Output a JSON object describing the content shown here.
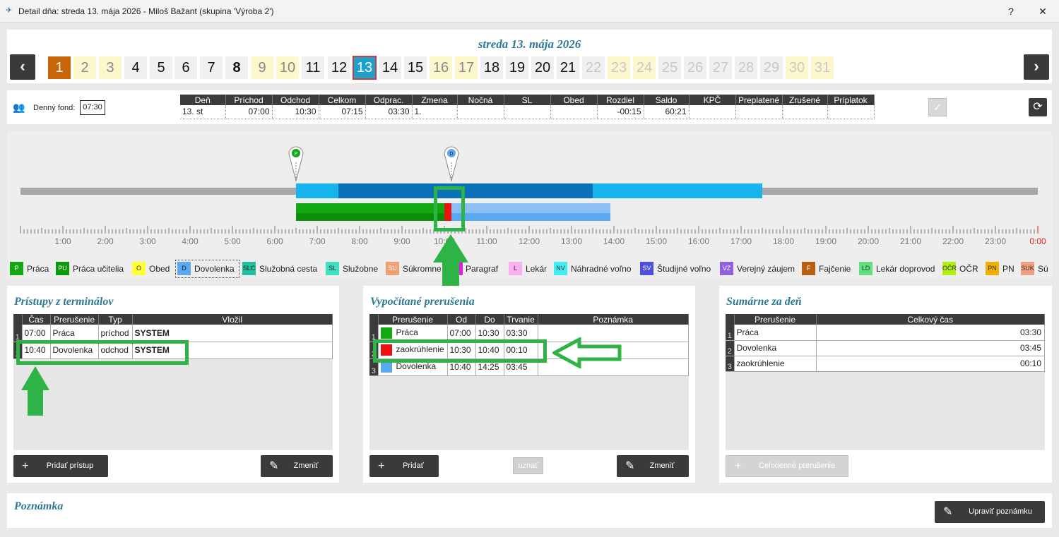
{
  "window": {
    "title": "Detail dňa: streda 13. mája 2026 -  Miloš Bažant  (skupina 'Výroba 2')",
    "help": "?",
    "close": "✕"
  },
  "calendar": {
    "date_title": "streda 13. mája 2026",
    "prev": "‹",
    "next": "›",
    "days": [
      "1",
      "2",
      "3",
      "4",
      "5",
      "6",
      "7",
      "8",
      "9",
      "10",
      "11",
      "12",
      "13",
      "14",
      "15",
      "16",
      "17",
      "18",
      "19",
      "20",
      "21",
      "22",
      "23",
      "24",
      "25",
      "26",
      "27",
      "28",
      "29",
      "30",
      "31"
    ]
  },
  "summary": {
    "fund_label": "Denný fond:",
    "fund_value": "07:30",
    "headers": [
      "Deň",
      "Príchod",
      "Odchod",
      "Celkom",
      "Odprac.",
      "Zmena",
      "Nočná",
      "SL",
      "Obed",
      "Rozdiel",
      "Saldo",
      "KPČ",
      "Preplatené",
      "Zrušené",
      "Príplatok"
    ],
    "row": [
      "13. st",
      "07:00",
      "10:30",
      "07:15",
      "03:30",
      "1.",
      "",
      "",
      "",
      "-00:15",
      "60:21",
      "",
      "",
      "",
      ""
    ],
    "check": "✓",
    "refresh": "⟳"
  },
  "timeline": {
    "markers": [
      {
        "letter": "P",
        "color": "#12a812"
      },
      {
        "letter": "D",
        "color": "#5aa8f0"
      }
    ],
    "hours": [
      "1:00",
      "2:00",
      "3:00",
      "4:00",
      "5:00",
      "6:00",
      "7:00",
      "8:00",
      "9:00",
      "10:00",
      "11:00",
      "12:00",
      "13:00",
      "14:00",
      "15:00",
      "16:00",
      "17:00",
      "18:00",
      "19:00",
      "20:00",
      "21:00",
      "22:00",
      "23:00",
      "0:00"
    ]
  },
  "legend": [
    {
      "code": "P",
      "label": "Práca",
      "color": "#12a812",
      "fg": "#fff"
    },
    {
      "code": "PU",
      "label": "Práca učitelia",
      "color": "#0a9a0a",
      "fg": "#fff"
    },
    {
      "code": "O",
      "label": "Obed",
      "color": "#ffff33",
      "fg": "#333"
    },
    {
      "code": "D",
      "label": "Dovolenka",
      "color": "#5aa8f0",
      "fg": "#222"
    },
    {
      "code": "SLC",
      "label": "Služobná cesta",
      "color": "#20c0a0",
      "fg": "#222"
    },
    {
      "code": "SL",
      "label": "Služobne",
      "color": "#40e0c0",
      "fg": "#222"
    },
    {
      "code": "SU",
      "label": "Súkromne",
      "color": "#f0a070",
      "fg": "#fff"
    },
    {
      "code": "",
      "label": "Paragraf",
      "color": "#e020e0",
      "fg": "#fff"
    },
    {
      "code": "L",
      "label": "Lekár",
      "color": "#f8b0f0",
      "fg": "#333"
    },
    {
      "code": "NV",
      "label": "Náhradné voľno",
      "color": "#40f0f0",
      "fg": "#333"
    },
    {
      "code": "SV",
      "label": "Študijné voľno",
      "color": "#5050e0",
      "fg": "#fff"
    },
    {
      "code": "VZ",
      "label": "Verejný záujem",
      "color": "#9060e0",
      "fg": "#fff"
    },
    {
      "code": "F",
      "label": "Fajčenie",
      "color": "#b86010",
      "fg": "#fff"
    },
    {
      "code": "LD",
      "label": "Lekár doprovod",
      "color": "#60e080",
      "fg": "#333"
    },
    {
      "code": "OČR",
      "label": "OČR",
      "color": "#b0f010",
      "fg": "#333"
    },
    {
      "code": "PN",
      "label": "PN",
      "color": "#f0b000",
      "fg": "#333"
    },
    {
      "code": "SUK",
      "label": "Sú",
      "color": "#f0a080",
      "fg": "#333"
    }
  ],
  "access": {
    "title": "Prístupy z terminálov",
    "headers": [
      "Čas",
      "Prerušenie",
      "Typ",
      "Vložil"
    ],
    "rows": [
      {
        "n": "1",
        "time": "07:00",
        "type": "Práca",
        "dir": "príchod",
        "by": "SYSTEM"
      },
      {
        "n": "2",
        "time": "10:40",
        "type": "Dovolenka",
        "dir": "odchod",
        "by": "SYSTEM"
      }
    ],
    "add": "Pridať prístup",
    "edit": "Zmeniť"
  },
  "breaks": {
    "title": "Vypočítané prerušenia",
    "headers": [
      "Prerušenie",
      "Od",
      "Do",
      "Trvanie",
      "Poznámka"
    ],
    "rows": [
      {
        "n": "1",
        "color": "#12a812",
        "label": "Práca",
        "from": "07:00",
        "to": "10:30",
        "dur": "03:30"
      },
      {
        "n": "2",
        "color": "#ee1111",
        "label": "zaokrúhlenie",
        "from": "10:30",
        "to": "10:40",
        "dur": "00:10"
      },
      {
        "n": "3",
        "color": "#5aa8f0",
        "label": "Dovolenka",
        "from": "10:40",
        "to": "14:25",
        "dur": "03:45"
      }
    ],
    "add": "Pridať",
    "accept": "uznať",
    "edit": "Zmeniť"
  },
  "totals": {
    "title": "Sumárne za deň",
    "headers": [
      "Prerušenie",
      "Celkový čas"
    ],
    "rows": [
      {
        "n": "1",
        "label": "Práca",
        "time": "03:30"
      },
      {
        "n": "2",
        "label": "Dovolenka",
        "time": "03:45"
      },
      {
        "n": "3",
        "label": "zaokrúhlenie",
        "time": "00:10"
      }
    ],
    "allday": "Celodenné prerušenie"
  },
  "note": {
    "title": "Poznámka",
    "edit": "Upraviť poznámku"
  }
}
